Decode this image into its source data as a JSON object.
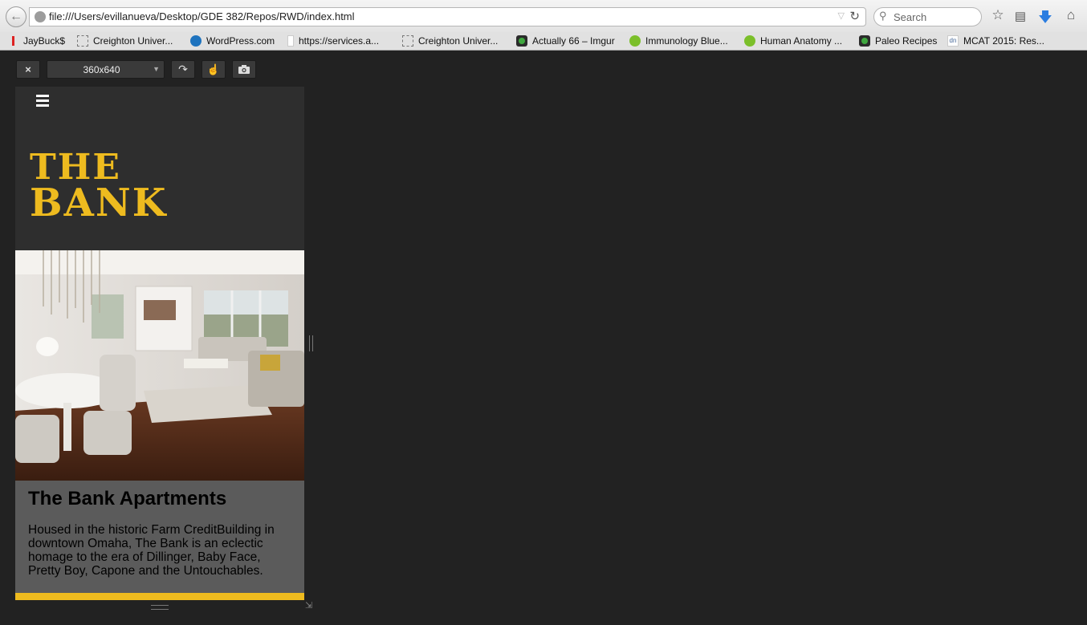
{
  "browser": {
    "url": "file:///Users/evillanueva/Desktop/GDE 382/Repos/RWD/index.html",
    "search_placeholder": "Search",
    "bookmarks": [
      {
        "label": "JayBuck$",
        "icon": "jaybucks-icon",
        "color": "#d22"
      },
      {
        "label": "Creighton Univer...",
        "icon": "page-icon",
        "color": "#888"
      },
      {
        "label": "WordPress.com",
        "icon": "wordpress-icon",
        "color": "#1e73be"
      },
      {
        "label": "https://services.a...",
        "icon": "feed-icon",
        "color": "#2a5aa8"
      },
      {
        "label": "Creighton Univer...",
        "icon": "page-icon",
        "color": "#888"
      },
      {
        "label": "Actually 66 – Imgur",
        "icon": "imgur-icon",
        "color": "#3fa83f"
      },
      {
        "label": "Immunology Blue...",
        "icon": "play-icon",
        "color": "#7bbf2a"
      },
      {
        "label": "Human Anatomy ...",
        "icon": "play-icon",
        "color": "#7bbf2a"
      },
      {
        "label": "Paleo Recipes",
        "icon": "green-dot-icon",
        "color": "#3fa83f"
      },
      {
        "label": "MCAT 2015: Res...",
        "icon": "dn-icon",
        "color": "#4a6a9a"
      }
    ]
  },
  "responsive_toolbar": {
    "close_label": "×",
    "size_value": "360x640",
    "rotate_icon": "rotate-icon",
    "touch_icon": "touch-icon",
    "screenshot_icon": "camera-icon"
  },
  "page": {
    "logo_line1": "THE",
    "logo_line2": "BANK",
    "heading": "The Bank Apartments",
    "body": "Housed in the historic Farm CreditBuilding in downtown Omaha, The Bank is an eclectic homage to the era of Dillinger, Baby Face, Pretty Boy, Capone and the Untouchables.",
    "colors": {
      "accent": "#eebb1f",
      "header_bg": "#2e2e2e",
      "content_bg": "#5b5b5b"
    }
  }
}
